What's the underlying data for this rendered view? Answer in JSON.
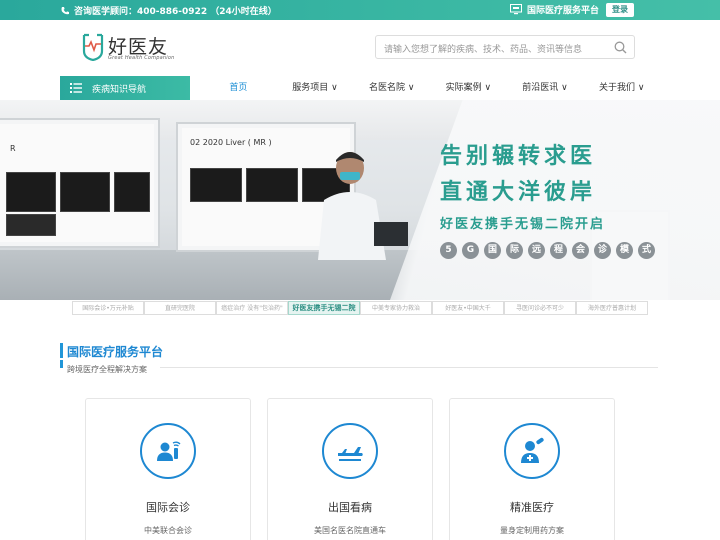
{
  "topbar": {
    "phone_label": "咨询医学顾问：400-886-0922  （24小时在线）",
    "platform_label": "国际医疗服务平台",
    "login_label": "登录"
  },
  "logo": {
    "name": "好医友",
    "tagline": "Great Health Companion"
  },
  "search": {
    "placeholder": "请输入您想了解的疾病、技术、药品、资讯等信息"
  },
  "nav": {
    "category_label": "疾病知识导航",
    "items": [
      {
        "label": "首页",
        "active": true
      },
      {
        "label": "服务项目 ∨"
      },
      {
        "label": "名医名院 ∨"
      },
      {
        "label": "实际案例 ∨"
      },
      {
        "label": "前沿医讯 ∨"
      },
      {
        "label": "关于我们 ∨"
      }
    ]
  },
  "banner": {
    "headline1": "告别辗转求医",
    "headline2": "直通大洋彼岸",
    "headline3": "好医友携手无锡二院开启",
    "monitor_text": "02 2020 Liver ( MR )",
    "monitor_text_left": "R",
    "mode_chars": [
      "5",
      "G",
      "国",
      "际",
      "远",
      "程",
      "会",
      "诊",
      "模",
      "式"
    ]
  },
  "tabs": [
    {
      "label": "国际会诊•万元补贴"
    },
    {
      "label": "直研完医院"
    },
    {
      "label": "癌症治疗 没有\"包治药\""
    },
    {
      "label": "好医友携手无锡二院",
      "active": true
    },
    {
      "label": "中美专家协力救治"
    },
    {
      "label": "好医友•中国大千"
    },
    {
      "label": "寻医问诊必不可少"
    },
    {
      "label": "海外医疗普惠计划"
    }
  ],
  "section": {
    "title": "国际医疗服务平台",
    "subtitle": "跨境医疗全程解决方案"
  },
  "cards": [
    {
      "title": "国际会诊",
      "desc": "中美联合会诊",
      "icon": "consultation-icon"
    },
    {
      "title": "出国看病",
      "desc": "美国名医名院直通车",
      "icon": "airplane-icon"
    },
    {
      "title": "精准医疗",
      "desc": "量身定制用药方案",
      "icon": "doctor-icon"
    }
  ],
  "colors": {
    "brand_teal": "#2aa89c",
    "accent_blue": "#1e88d2",
    "headline_teal": "#2a9d8f"
  }
}
